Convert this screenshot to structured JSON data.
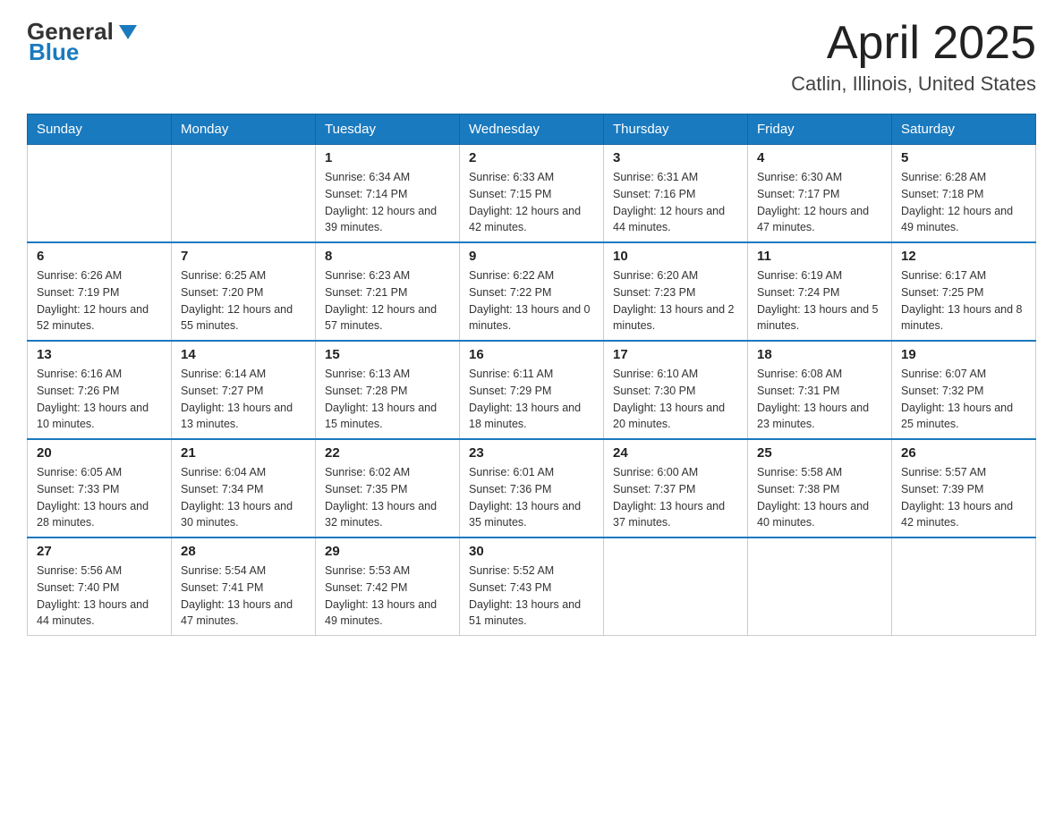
{
  "header": {
    "logo": {
      "general": "General",
      "blue": "Blue"
    },
    "title": "April 2025",
    "location": "Catlin, Illinois, United States"
  },
  "days_of_week": [
    "Sunday",
    "Monday",
    "Tuesday",
    "Wednesday",
    "Thursday",
    "Friday",
    "Saturday"
  ],
  "weeks": [
    [
      {
        "day": "",
        "sunrise": "",
        "sunset": "",
        "daylight": ""
      },
      {
        "day": "",
        "sunrise": "",
        "sunset": "",
        "daylight": ""
      },
      {
        "day": "1",
        "sunrise": "Sunrise: 6:34 AM",
        "sunset": "Sunset: 7:14 PM",
        "daylight": "Daylight: 12 hours and 39 minutes."
      },
      {
        "day": "2",
        "sunrise": "Sunrise: 6:33 AM",
        "sunset": "Sunset: 7:15 PM",
        "daylight": "Daylight: 12 hours and 42 minutes."
      },
      {
        "day": "3",
        "sunrise": "Sunrise: 6:31 AM",
        "sunset": "Sunset: 7:16 PM",
        "daylight": "Daylight: 12 hours and 44 minutes."
      },
      {
        "day": "4",
        "sunrise": "Sunrise: 6:30 AM",
        "sunset": "Sunset: 7:17 PM",
        "daylight": "Daylight: 12 hours and 47 minutes."
      },
      {
        "day": "5",
        "sunrise": "Sunrise: 6:28 AM",
        "sunset": "Sunset: 7:18 PM",
        "daylight": "Daylight: 12 hours and 49 minutes."
      }
    ],
    [
      {
        "day": "6",
        "sunrise": "Sunrise: 6:26 AM",
        "sunset": "Sunset: 7:19 PM",
        "daylight": "Daylight: 12 hours and 52 minutes."
      },
      {
        "day": "7",
        "sunrise": "Sunrise: 6:25 AM",
        "sunset": "Sunset: 7:20 PM",
        "daylight": "Daylight: 12 hours and 55 minutes."
      },
      {
        "day": "8",
        "sunrise": "Sunrise: 6:23 AM",
        "sunset": "Sunset: 7:21 PM",
        "daylight": "Daylight: 12 hours and 57 minutes."
      },
      {
        "day": "9",
        "sunrise": "Sunrise: 6:22 AM",
        "sunset": "Sunset: 7:22 PM",
        "daylight": "Daylight: 13 hours and 0 minutes."
      },
      {
        "day": "10",
        "sunrise": "Sunrise: 6:20 AM",
        "sunset": "Sunset: 7:23 PM",
        "daylight": "Daylight: 13 hours and 2 minutes."
      },
      {
        "day": "11",
        "sunrise": "Sunrise: 6:19 AM",
        "sunset": "Sunset: 7:24 PM",
        "daylight": "Daylight: 13 hours and 5 minutes."
      },
      {
        "day": "12",
        "sunrise": "Sunrise: 6:17 AM",
        "sunset": "Sunset: 7:25 PM",
        "daylight": "Daylight: 13 hours and 8 minutes."
      }
    ],
    [
      {
        "day": "13",
        "sunrise": "Sunrise: 6:16 AM",
        "sunset": "Sunset: 7:26 PM",
        "daylight": "Daylight: 13 hours and 10 minutes."
      },
      {
        "day": "14",
        "sunrise": "Sunrise: 6:14 AM",
        "sunset": "Sunset: 7:27 PM",
        "daylight": "Daylight: 13 hours and 13 minutes."
      },
      {
        "day": "15",
        "sunrise": "Sunrise: 6:13 AM",
        "sunset": "Sunset: 7:28 PM",
        "daylight": "Daylight: 13 hours and 15 minutes."
      },
      {
        "day": "16",
        "sunrise": "Sunrise: 6:11 AM",
        "sunset": "Sunset: 7:29 PM",
        "daylight": "Daylight: 13 hours and 18 minutes."
      },
      {
        "day": "17",
        "sunrise": "Sunrise: 6:10 AM",
        "sunset": "Sunset: 7:30 PM",
        "daylight": "Daylight: 13 hours and 20 minutes."
      },
      {
        "day": "18",
        "sunrise": "Sunrise: 6:08 AM",
        "sunset": "Sunset: 7:31 PM",
        "daylight": "Daylight: 13 hours and 23 minutes."
      },
      {
        "day": "19",
        "sunrise": "Sunrise: 6:07 AM",
        "sunset": "Sunset: 7:32 PM",
        "daylight": "Daylight: 13 hours and 25 minutes."
      }
    ],
    [
      {
        "day": "20",
        "sunrise": "Sunrise: 6:05 AM",
        "sunset": "Sunset: 7:33 PM",
        "daylight": "Daylight: 13 hours and 28 minutes."
      },
      {
        "day": "21",
        "sunrise": "Sunrise: 6:04 AM",
        "sunset": "Sunset: 7:34 PM",
        "daylight": "Daylight: 13 hours and 30 minutes."
      },
      {
        "day": "22",
        "sunrise": "Sunrise: 6:02 AM",
        "sunset": "Sunset: 7:35 PM",
        "daylight": "Daylight: 13 hours and 32 minutes."
      },
      {
        "day": "23",
        "sunrise": "Sunrise: 6:01 AM",
        "sunset": "Sunset: 7:36 PM",
        "daylight": "Daylight: 13 hours and 35 minutes."
      },
      {
        "day": "24",
        "sunrise": "Sunrise: 6:00 AM",
        "sunset": "Sunset: 7:37 PM",
        "daylight": "Daylight: 13 hours and 37 minutes."
      },
      {
        "day": "25",
        "sunrise": "Sunrise: 5:58 AM",
        "sunset": "Sunset: 7:38 PM",
        "daylight": "Daylight: 13 hours and 40 minutes."
      },
      {
        "day": "26",
        "sunrise": "Sunrise: 5:57 AM",
        "sunset": "Sunset: 7:39 PM",
        "daylight": "Daylight: 13 hours and 42 minutes."
      }
    ],
    [
      {
        "day": "27",
        "sunrise": "Sunrise: 5:56 AM",
        "sunset": "Sunset: 7:40 PM",
        "daylight": "Daylight: 13 hours and 44 minutes."
      },
      {
        "day": "28",
        "sunrise": "Sunrise: 5:54 AM",
        "sunset": "Sunset: 7:41 PM",
        "daylight": "Daylight: 13 hours and 47 minutes."
      },
      {
        "day": "29",
        "sunrise": "Sunrise: 5:53 AM",
        "sunset": "Sunset: 7:42 PM",
        "daylight": "Daylight: 13 hours and 49 minutes."
      },
      {
        "day": "30",
        "sunrise": "Sunrise: 5:52 AM",
        "sunset": "Sunset: 7:43 PM",
        "daylight": "Daylight: 13 hours and 51 minutes."
      },
      {
        "day": "",
        "sunrise": "",
        "sunset": "",
        "daylight": ""
      },
      {
        "day": "",
        "sunrise": "",
        "sunset": "",
        "daylight": ""
      },
      {
        "day": "",
        "sunrise": "",
        "sunset": "",
        "daylight": ""
      }
    ]
  ]
}
